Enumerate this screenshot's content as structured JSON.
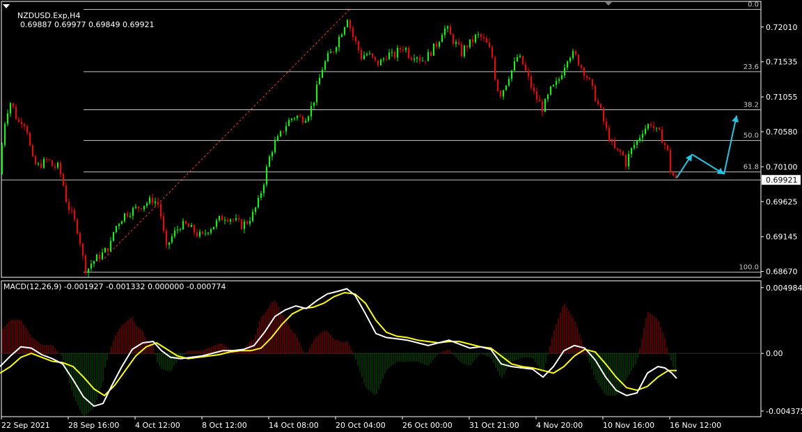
{
  "header": {
    "symbol": "NZDUSD.Exp,H4",
    "ohlc": "0.69887 0.69977 0.69849 0.69921"
  },
  "macd_header": "MACD(12,26,9) -0.001927 -0.001332 0.000000 -0.000774",
  "colors": {
    "background": "#000000",
    "bull": "#00ff00",
    "bear": "#ff0000",
    "grid": "#ffffff",
    "fib_line": "#c8c8c8",
    "arrow": "#1ec8e6",
    "macd_line": "#ffffff",
    "signal_line": "#ffff00",
    "hist_pos": "#b00000",
    "hist_neg": "#006000",
    "current_price_bg": "#ffffff"
  },
  "chart_data": {
    "type": "candlestick",
    "symbol": "NZDUSD.Exp",
    "timeframe": "H4",
    "price_ticks": [
      "0.72010",
      "0.71535",
      "0.71055",
      "0.70580",
      "0.70100",
      "0.69625",
      "0.69145",
      "0.68670"
    ],
    "current_price": "0.69921",
    "ylim": [
      0.6859,
      0.7236
    ],
    "time_labels": [
      "22 Sep 2021",
      "28 Sep 16:00",
      "4 Oct 12:00",
      "8 Oct 12:00",
      "14 Oct 08:00",
      "20 Oct 04:00",
      "26 Oct 00:00",
      "31 Oct 21:00",
      "4 Nov 20:00",
      "10 Nov 16:00",
      "16 Nov 12:00"
    ],
    "fibonacci": {
      "high": 0.7225,
      "low": 0.6866,
      "levels": [
        {
          "label": "0.0",
          "value": 0.7225
        },
        {
          "label": "23.6",
          "value": 0.714
        },
        {
          "label": "38.2",
          "value": 0.7088
        },
        {
          "label": "50.0",
          "value": 0.7046
        },
        {
          "label": "61.8",
          "value": 0.7003
        },
        {
          "label": "100.0",
          "value": 0.6866
        }
      ]
    },
    "price_path": [
      [
        0,
        0.7
      ],
      [
        3,
        0.706
      ],
      [
        8,
        0.708
      ],
      [
        13,
        0.71
      ],
      [
        18,
        0.709
      ],
      [
        25,
        0.707
      ],
      [
        32,
        0.7075
      ],
      [
        38,
        0.706
      ],
      [
        45,
        0.702
      ],
      [
        52,
        0.701
      ],
      [
        60,
        0.7015
      ],
      [
        68,
        0.702
      ],
      [
        75,
        0.701
      ],
      [
        82,
        0.701
      ],
      [
        88,
        0.6995
      ],
      [
        95,
        0.696
      ],
      [
        102,
        0.6945
      ],
      [
        110,
        0.6925
      ],
      [
        116,
        0.69
      ],
      [
        120,
        0.6872
      ],
      [
        125,
        0.687
      ],
      [
        130,
        0.6878
      ],
      [
        138,
        0.6885
      ],
      [
        145,
        0.689
      ],
      [
        152,
        0.6897
      ],
      [
        158,
        0.6905
      ],
      [
        163,
        0.6925
      ],
      [
        170,
        0.6935
      ],
      [
        178,
        0.6945
      ],
      [
        188,
        0.695
      ],
      [
        198,
        0.6955
      ],
      [
        208,
        0.696
      ],
      [
        218,
        0.6965
      ],
      [
        226,
        0.696
      ],
      [
        232,
        0.6935
      ],
      [
        237,
        0.6895
      ],
      [
        243,
        0.691
      ],
      [
        250,
        0.692
      ],
      [
        258,
        0.693
      ],
      [
        266,
        0.693
      ],
      [
        274,
        0.6925
      ],
      [
        282,
        0.6918
      ],
      [
        290,
        0.6915
      ],
      [
        298,
        0.6925
      ],
      [
        306,
        0.693
      ],
      [
        314,
        0.6938
      ],
      [
        322,
        0.6942
      ],
      [
        330,
        0.694
      ],
      [
        338,
        0.6935
      ],
      [
        346,
        0.693
      ],
      [
        354,
        0.6935
      ],
      [
        362,
        0.6945
      ],
      [
        370,
        0.6962
      ],
      [
        378,
        0.699
      ],
      [
        385,
        0.702
      ],
      [
        392,
        0.704
      ],
      [
        400,
        0.705
      ],
      [
        408,
        0.7065
      ],
      [
        416,
        0.7075
      ],
      [
        424,
        0.708
      ],
      [
        432,
        0.7075
      ],
      [
        440,
        0.708
      ],
      [
        448,
        0.7095
      ],
      [
        455,
        0.712
      ],
      [
        462,
        0.7145
      ],
      [
        470,
        0.716
      ],
      [
        478,
        0.717
      ],
      [
        485,
        0.7185
      ],
      [
        492,
        0.72
      ],
      [
        498,
        0.7215
      ],
      [
        505,
        0.719
      ],
      [
        512,
        0.7175
      ],
      [
        518,
        0.716
      ],
      [
        525,
        0.7165
      ],
      [
        532,
        0.716
      ],
      [
        540,
        0.715
      ],
      [
        548,
        0.7155
      ],
      [
        556,
        0.7165
      ],
      [
        564,
        0.716
      ],
      [
        572,
        0.717
      ],
      [
        580,
        0.7175
      ],
      [
        588,
        0.716
      ],
      [
        596,
        0.7165
      ],
      [
        604,
        0.7155
      ],
      [
        612,
        0.716
      ],
      [
        620,
        0.717
      ],
      [
        628,
        0.718
      ],
      [
        634,
        0.7195
      ],
      [
        640,
        0.72
      ],
      [
        648,
        0.7185
      ],
      [
        656,
        0.7175
      ],
      [
        662,
        0.7165
      ],
      [
        668,
        0.7175
      ],
      [
        676,
        0.718
      ],
      [
        684,
        0.719
      ],
      [
        692,
        0.7185
      ],
      [
        700,
        0.7175
      ],
      [
        706,
        0.716
      ],
      [
        712,
        0.712
      ],
      [
        718,
        0.711
      ],
      [
        724,
        0.712
      ],
      [
        730,
        0.7135
      ],
      [
        736,
        0.7145
      ],
      [
        742,
        0.716
      ],
      [
        748,
        0.7155
      ],
      [
        754,
        0.714
      ],
      [
        760,
        0.7125
      ],
      [
        766,
        0.711
      ],
      [
        772,
        0.71
      ],
      [
        778,
        0.709
      ],
      [
        784,
        0.71
      ],
      [
        790,
        0.7115
      ],
      [
        796,
        0.712
      ],
      [
        802,
        0.713
      ],
      [
        808,
        0.7145
      ],
      [
        814,
        0.716
      ],
      [
        820,
        0.7165
      ],
      [
        826,
        0.716
      ],
      [
        832,
        0.715
      ],
      [
        838,
        0.714
      ],
      [
        844,
        0.713
      ],
      [
        850,
        0.7115
      ],
      [
        856,
        0.71
      ],
      [
        862,
        0.7085
      ],
      [
        868,
        0.7065
      ],
      [
        874,
        0.705
      ],
      [
        880,
        0.7035
      ],
      [
        886,
        0.703
      ],
      [
        892,
        0.703
      ],
      [
        898,
        0.7015
      ],
      [
        904,
        0.703
      ],
      [
        910,
        0.704
      ],
      [
        916,
        0.7048
      ],
      [
        922,
        0.706
      ],
      [
        928,
        0.7065
      ],
      [
        934,
        0.707
      ],
      [
        940,
        0.706
      ],
      [
        946,
        0.7055
      ],
      [
        952,
        0.7045
      ],
      [
        958,
        0.703
      ],
      [
        962,
        0.7005
      ],
      [
        966,
        0.6998
      ],
      [
        970,
        0.6992
      ]
    ],
    "projection": [
      [
        972,
        0.6995
      ],
      [
        994,
        0.7027
      ],
      [
        1040,
        0.7
      ],
      [
        1058,
        0.708
      ]
    ],
    "macd": {
      "ylim": [
        -0.0048,
        0.0055
      ],
      "ticks": [
        "0.004984",
        "0.00",
        "-0.004375"
      ],
      "main_path": [
        [
          0,
          -0.001
        ],
        [
          15,
          -0.0002
        ],
        [
          30,
          0.0005
        ],
        [
          45,
          0.0004
        ],
        [
          60,
          -0.0001
        ],
        [
          75,
          -0.0004
        ],
        [
          90,
          -0.0008
        ],
        [
          105,
          -0.002
        ],
        [
          120,
          -0.0033
        ],
        [
          135,
          -0.004
        ],
        [
          148,
          -0.0038
        ],
        [
          160,
          -0.0025
        ],
        [
          175,
          -0.001
        ],
        [
          190,
          0.0003
        ],
        [
          205,
          0.0008
        ],
        [
          220,
          0.0009
        ],
        [
          232,
          0.0002
        ],
        [
          245,
          -0.0003
        ],
        [
          260,
          -0.0004
        ],
        [
          275,
          -0.0003
        ],
        [
          290,
          -0.0002
        ],
        [
          305,
          0.0
        ],
        [
          320,
          0.0002
        ],
        [
          335,
          0.0002
        ],
        [
          350,
          0.0003
        ],
        [
          365,
          0.0006
        ],
        [
          380,
          0.0016
        ],
        [
          395,
          0.0028
        ],
        [
          410,
          0.0033
        ],
        [
          425,
          0.0036
        ],
        [
          440,
          0.0034
        ],
        [
          455,
          0.004
        ],
        [
          470,
          0.0045
        ],
        [
          485,
          0.0047
        ],
        [
          498,
          0.0049
        ],
        [
          510,
          0.0044
        ],
        [
          525,
          0.003
        ],
        [
          540,
          0.0015
        ],
        [
          555,
          0.0012
        ],
        [
          570,
          0.0011
        ],
        [
          585,
          0.001
        ],
        [
          600,
          0.0008
        ],
        [
          615,
          0.0006
        ],
        [
          630,
          0.0008
        ],
        [
          645,
          0.001
        ],
        [
          660,
          0.0007
        ],
        [
          675,
          0.0004
        ],
        [
          690,
          0.0005
        ],
        [
          705,
          0.0003
        ],
        [
          720,
          -0.0008
        ],
        [
          735,
          -0.001
        ],
        [
          750,
          -0.0011
        ],
        [
          765,
          -0.0012
        ],
        [
          780,
          -0.0018
        ],
        [
          795,
          -0.001
        ],
        [
          810,
          0.0002
        ],
        [
          825,
          0.0006
        ],
        [
          840,
          0.0004
        ],
        [
          855,
          -0.0005
        ],
        [
          870,
          -0.0018
        ],
        [
          885,
          -0.0028
        ],
        [
          900,
          -0.0032
        ],
        [
          915,
          -0.003
        ],
        [
          930,
          -0.0015
        ],
        [
          945,
          -0.001
        ],
        [
          955,
          -0.0011
        ],
        [
          965,
          -0.0015
        ],
        [
          972,
          -0.0019
        ]
      ],
      "signal_path": [
        [
          0,
          -0.0015
        ],
        [
          15,
          -0.001
        ],
        [
          30,
          -0.0003
        ],
        [
          45,
          0.0
        ],
        [
          60,
          -0.0003
        ],
        [
          75,
          -0.0006
        ],
        [
          90,
          -0.0007
        ],
        [
          105,
          -0.001
        ],
        [
          120,
          -0.0018
        ],
        [
          135,
          -0.0027
        ],
        [
          150,
          -0.0032
        ],
        [
          165,
          -0.0024
        ],
        [
          180,
          -0.0013
        ],
        [
          195,
          -0.0002
        ],
        [
          210,
          0.0005
        ],
        [
          225,
          0.0008
        ],
        [
          240,
          0.0003
        ],
        [
          255,
          -0.0002
        ],
        [
          270,
          -0.0004
        ],
        [
          285,
          -0.0003
        ],
        [
          300,
          -0.0002
        ],
        [
          315,
          -0.0001
        ],
        [
          330,
          0.0001
        ],
        [
          345,
          0.0002
        ],
        [
          360,
          0.0002
        ],
        [
          375,
          0.0004
        ],
        [
          390,
          0.0012
        ],
        [
          405,
          0.0022
        ],
        [
          420,
          0.003
        ],
        [
          435,
          0.0034
        ],
        [
          450,
          0.0035
        ],
        [
          465,
          0.0038
        ],
        [
          480,
          0.0043
        ],
        [
          495,
          0.0046
        ],
        [
          510,
          0.0045
        ],
        [
          525,
          0.0038
        ],
        [
          540,
          0.0025
        ],
        [
          555,
          0.0016
        ],
        [
          570,
          0.0013
        ],
        [
          585,
          0.0012
        ],
        [
          600,
          0.001
        ],
        [
          615,
          0.0009
        ],
        [
          630,
          0.0008
        ],
        [
          645,
          0.0009
        ],
        [
          660,
          0.0009
        ],
        [
          675,
          0.0007
        ],
        [
          690,
          0.0005
        ],
        [
          705,
          0.0004
        ],
        [
          720,
          -0.0002
        ],
        [
          735,
          -0.0008
        ],
        [
          750,
          -0.001
        ],
        [
          765,
          -0.0011
        ],
        [
          780,
          -0.0013
        ],
        [
          795,
          -0.0015
        ],
        [
          810,
          -0.001
        ],
        [
          825,
          -0.0002
        ],
        [
          840,
          0.0003
        ],
        [
          855,
          0.0001
        ],
        [
          870,
          -0.0008
        ],
        [
          885,
          -0.0018
        ],
        [
          900,
          -0.0026
        ],
        [
          915,
          -0.0028
        ],
        [
          930,
          -0.0025
        ],
        [
          945,
          -0.0018
        ],
        [
          960,
          -0.0013
        ],
        [
          972,
          -0.0013
        ]
      ]
    }
  }
}
